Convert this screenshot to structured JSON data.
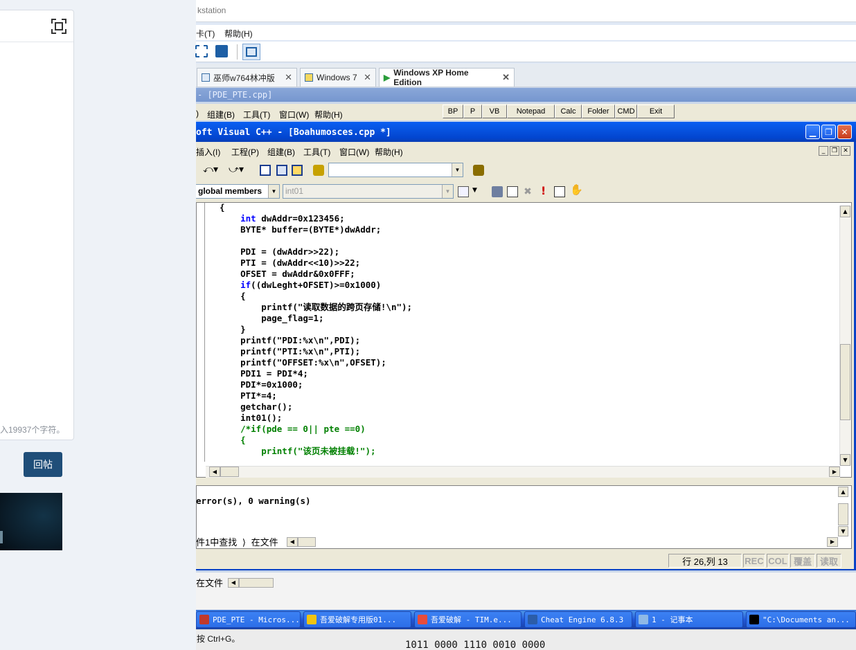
{
  "forum": {
    "char_hint": "入19937个字符。",
    "reply_button": "回帖"
  },
  "vmware": {
    "title": "kstation",
    "menu": [
      "卡(T)",
      "帮助(H)"
    ],
    "tabs": [
      {
        "label": "巫师w764林冲版",
        "active": false
      },
      {
        "label": "Windows 7",
        "active": false
      },
      {
        "label": "Windows XP Home Edition",
        "active": true
      }
    ]
  },
  "xp": {
    "outer_title": "- [PDE_PTE.cpp]",
    "outer_menu": [
      ")",
      "组建(B)",
      "工具(T)",
      "窗口(W)",
      "帮助(H)"
    ],
    "quick_buttons": [
      "BP",
      "P",
      "VB",
      "Notepad",
      "Calc",
      "Folder",
      "CMD",
      "Exit"
    ],
    "vc": {
      "title": "oft Visual C++ - [Boahumosces.cpp *]",
      "menu": [
        "插入(I)",
        "工程(P)",
        "组建(B)",
        "工具(T)",
        "窗口(W)",
        "帮助(H)"
      ],
      "scope_combo": "global members",
      "function_combo": "int01",
      "code_lines": [
        "{",
        "    int dwAddr=0x123456;",
        "    BYTE* buffer=(BYTE*)dwAddr;",
        "",
        "    PDI = (dwAddr>>22);",
        "    PTI = (dwAddr<<10)>>22;",
        "    OFSET = dwAddr&0x0FFF;",
        "    if((dwLeght+OFSET)>=0x1000)",
        "    {",
        "        printf(\"读取数据的跨页存储!\\n\");",
        "        page_flag=1;",
        "    }",
        "    printf(\"PDI:%x\\n\",PDI);",
        "    printf(\"PTI:%x\\n\",PTI);",
        "    printf(\"OFFSET:%x\\n\",OFSET);",
        "    PDI1 = PDI*4;",
        "    PDI*=0x1000;",
        "    PTI*=4;",
        "    getchar();",
        "    int01();",
        "    /*if(pde == 0|| pte ==0)",
        "    {",
        "        printf(\"该页未被挂载!\");"
      ],
      "output_text": "error(s), 0 warning(s)",
      "output_tabs": [
        "件1中查找",
        "在文件"
      ],
      "status": {
        "position": "行 26,列 13",
        "indicators": [
          "REC",
          "COL",
          "覆盖",
          "读取"
        ]
      }
    },
    "under_tab": "在文件",
    "taskbar": [
      {
        "label": "PDE_PTE - Micros...",
        "icon_color": "#c0392b"
      },
      {
        "label": "吾爱破解专用版01...",
        "icon_color": "#f1c40f"
      },
      {
        "label": "吾爱破解 - TIM.e...",
        "icon_color": "#e74c3c"
      },
      {
        "label": "Cheat Engine 6.8.3",
        "icon_color": "#2c5da8"
      },
      {
        "label": "1 - 记事本",
        "icon_color": "#8fb9e6"
      },
      {
        "label": "\"C:\\Documents an...",
        "icon_color": "#000000"
      }
    ]
  },
  "host_status": "按 Ctrl+G。",
  "bottom_binary": "1011 0000 1110 0010 0000"
}
